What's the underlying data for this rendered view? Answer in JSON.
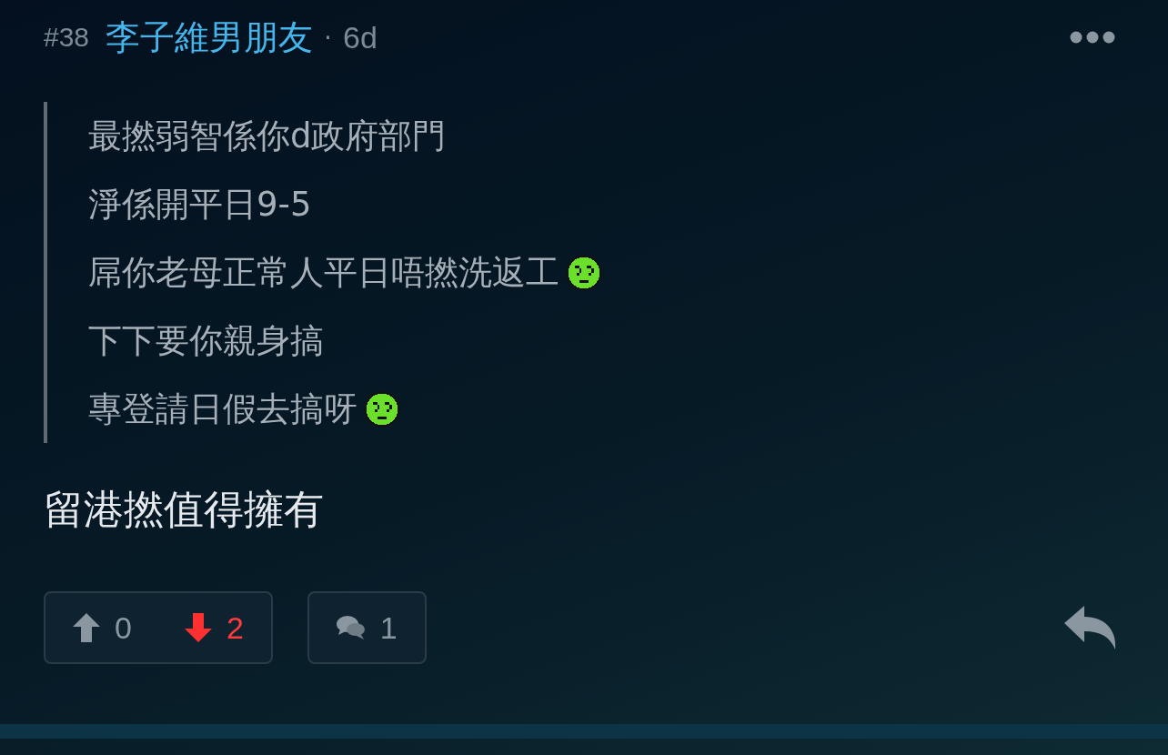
{
  "post": {
    "number": "#38",
    "author": "李子維男朋友",
    "separator": "·",
    "time": "6d",
    "quote": [
      {
        "text": "最撚弱智係你d政府部門",
        "emoji": false
      },
      {
        "text": "淨係開平日9-5",
        "emoji": false
      },
      {
        "text": "屌你老母正常人平日唔撚洗返工",
        "emoji": true
      },
      {
        "text": "下下要你親身搞",
        "emoji": false
      },
      {
        "text": "專登請日假去搞呀",
        "emoji": true
      }
    ],
    "body": "留港撚值得擁有",
    "upvotes": "0",
    "downvotes": "2",
    "replies": "1"
  }
}
